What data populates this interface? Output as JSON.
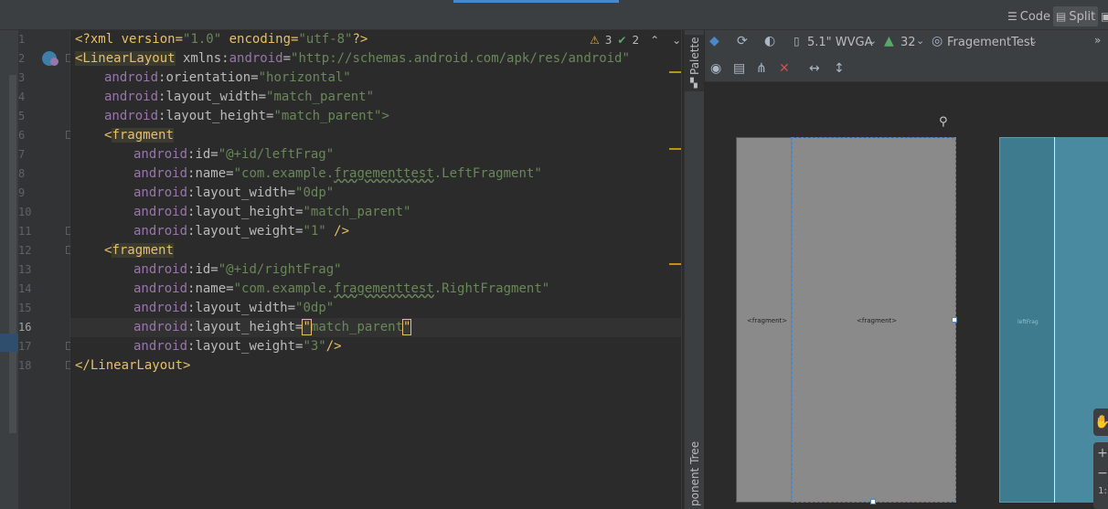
{
  "toolbar": {
    "code_label": "Code",
    "split_label": "Split"
  },
  "editor": {
    "lines": [
      {
        "num": "1"
      },
      {
        "num": "2"
      },
      {
        "num": "3"
      },
      {
        "num": "4"
      },
      {
        "num": "5"
      },
      {
        "num": "6"
      },
      {
        "num": "7"
      },
      {
        "num": "8"
      },
      {
        "num": "9"
      },
      {
        "num": "10"
      },
      {
        "num": "11"
      },
      {
        "num": "12"
      },
      {
        "num": "13"
      },
      {
        "num": "14"
      },
      {
        "num": "15"
      },
      {
        "num": "16"
      },
      {
        "num": "17"
      },
      {
        "num": "18"
      }
    ],
    "warnings_count": "3",
    "checks_count": "2",
    "current_line": "16"
  },
  "code": {
    "l1_a": "<?xml version=",
    "l1_b": "\"1.0\"",
    "l1_c": " encoding=",
    "l1_d": "\"utf-8\"",
    "l1_e": "?>",
    "l2_tag": "<LinearLayout",
    "l2_ns": " xmlns:",
    "l2_nsname": "android",
    "l2_eq": "=",
    "l2_val": "\"http://schemas.android.com/apk/res/android\"",
    "android": "android",
    "orientation_attr": ":orientation=",
    "orientation_val": "\"horizontal\"",
    "layout_width_attr": ":layout_width=",
    "layout_height_attr": ":layout_height=",
    "match_parent_val": "\"match_parent\"",
    "match_parent_close": "\"match_parent\">",
    "fragment_tag": "<fragment",
    "fragment_open": "<",
    "fragment_name": "fragment",
    "id_attr": ":id=",
    "id_left": "\"@+id/leftFrag\"",
    "id_right": "\"@+id/rightFrag\"",
    "name_attr": ":name=",
    "name_left_a": "\"com.example.",
    "name_left_b": "fragementtest",
    "name_left_c": ".LeftFragment\"",
    "name_right_c": ".RightFragment\"",
    "zero_dp": "\"0dp\"",
    "weight_attr": ":layout_weight=",
    "weight_1": "\"1\"",
    "weight_3": "\"3\"",
    "self_close": " />",
    "self_close2": "/>",
    "l16_q1": "\"",
    "l16_mid": "match_parent",
    "l16_q2": "\"",
    "close_tag": "</LinearLayout>"
  },
  "design": {
    "device_label": "5.1\" WVGA",
    "api_label": "32",
    "theme_label": "FragementTest",
    "palette_label": "Palette",
    "component_tree_label": "ponent Tree",
    "fragment_label_left": "<fragment>",
    "fragment_label_right": "<fragment>",
    "design_frag_label": "leftFrag"
  }
}
